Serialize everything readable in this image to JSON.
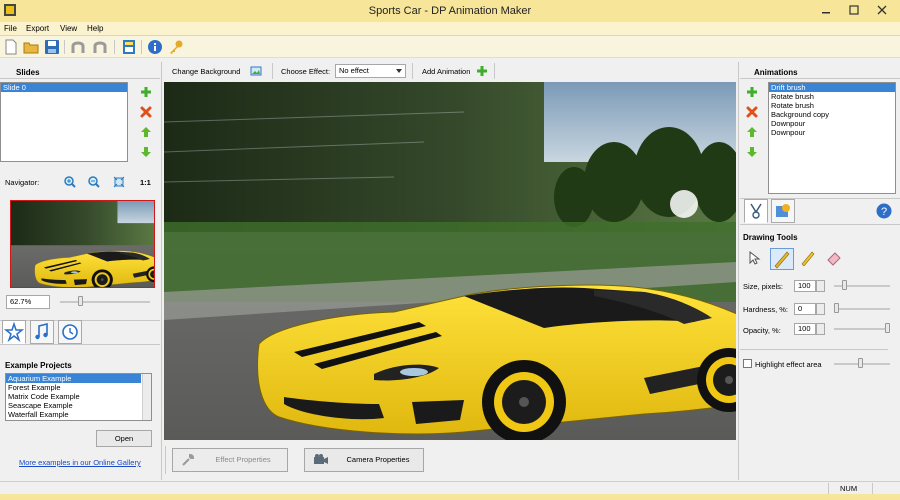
{
  "window": {
    "title": "Sports Car - DP Animation Maker"
  },
  "menu": [
    "File",
    "Export",
    "View",
    "Help"
  ],
  "slides": {
    "title": "Slides",
    "items": [
      {
        "label": "Slide 0",
        "selected": true
      }
    ],
    "navigator_label": "Navigator:",
    "zoom_one_to_one": "1:1",
    "zoom_value": "62.7%"
  },
  "examples": {
    "title": "Example Projects",
    "items": [
      {
        "label": "Aquarium Example",
        "selected": true
      },
      {
        "label": "Forest Example",
        "selected": false
      },
      {
        "label": "Matrix Code Example",
        "selected": false
      },
      {
        "label": "Seascape Example",
        "selected": false
      },
      {
        "label": "Waterfall Example",
        "selected": false
      }
    ],
    "open_label": "Open",
    "gallery_link": "More examples in our Online Gallery"
  },
  "center_toolbar": {
    "change_background": "Change Background",
    "choose_effect_label": "Choose Effect:",
    "effect_value": "No effect",
    "add_animation": "Add Animation"
  },
  "bottom_buttons": {
    "effect_properties": "Effect Properties",
    "camera_properties": "Camera Properties"
  },
  "animations": {
    "title": "Animations",
    "items": [
      {
        "label": "Drift brush",
        "selected": true
      },
      {
        "label": "Rotate brush",
        "selected": false
      },
      {
        "label": "Rotate brush",
        "selected": false
      },
      {
        "label": "Background copy",
        "selected": false
      },
      {
        "label": "Downpour",
        "selected": false
      },
      {
        "label": "Downpour",
        "selected": false
      }
    ]
  },
  "drawing_tools": {
    "title": "Drawing Tools",
    "size_label": "Size, pixels:",
    "size_value": "100",
    "size_level": 0.15,
    "hardness_label": "Hardness, %:",
    "hardness_value": "0",
    "hardness_level": 0.0,
    "opacity_label": "Opacity, %:",
    "opacity_value": "100",
    "opacity_level": 1.0,
    "highlight_label": "Highlight effect area",
    "highlight_checked": false
  },
  "status": {
    "num": "NUM"
  },
  "colors": {
    "titlebar": "#f7e59a",
    "accent_blue": "#3a84d6",
    "selection_red": "#d01818",
    "car_yellow": "#f3cf1a"
  }
}
